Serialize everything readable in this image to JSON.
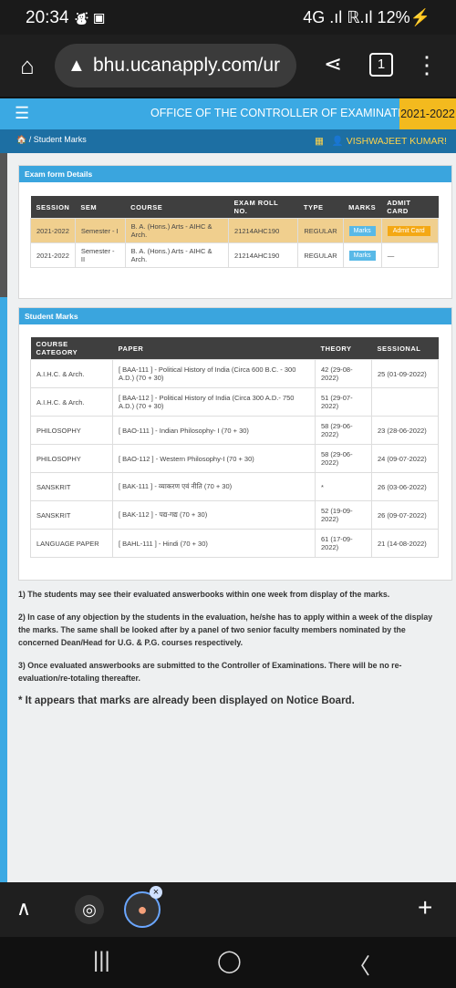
{
  "status_bar": {
    "time": "20:34",
    "icons": "⛇ ▣",
    "right": "4G .ıl ℝ.ıl 12%⚡"
  },
  "browser": {
    "url": "bhu.ucanapply.com/ur",
    "tab_count": "1"
  },
  "app_header": {
    "office_title": "OFFICE OF THE CONTROLLER OF EXAMINATIONS",
    "year": "2021-2022"
  },
  "breadcrumb": {
    "current": "Student Marks"
  },
  "user": {
    "name": "VISHWAJEET KUMAR!"
  },
  "exam_form": {
    "title": "Exam form Details",
    "columns": [
      "SESSION",
      "SEM",
      "COURSE",
      "EXAM ROLL NO.",
      "TYPE",
      "MARKS",
      "ADMIT CARD"
    ],
    "rows": [
      {
        "session": "2021-2022",
        "sem": "Semester - I",
        "course": "B. A. (Hons.) Arts - AIHC & Arch.",
        "roll": "21214AHC190",
        "type": "REGULAR",
        "marks": "Marks",
        "admit": "Admit Card"
      },
      {
        "session": "2021-2022",
        "sem": "Semester - II",
        "course": "B. A. (Hons.) Arts - AIHC & Arch.",
        "roll": "21214AHC190",
        "type": "REGULAR",
        "marks": "Marks",
        "admit": "—"
      }
    ]
  },
  "student_marks": {
    "title": "Student Marks",
    "columns": [
      "COURSE CATEGORY",
      "PAPER",
      "THEORY",
      "SESSIONAL"
    ],
    "rows": [
      {
        "category": "A.I.H.C. & Arch.",
        "paper": "[ BAA-111 ] - Political History of India (Circa 600 B.C. - 300 A.D.) (70 + 30)",
        "theory": "42 (29-08-2022)",
        "sessional": "25 (01-09-2022)"
      },
      {
        "category": "A.I.H.C. & Arch.",
        "paper": "[ BAA-112 ] - Political History of India (Circa 300 A.D.- 750 A.D.) (70 + 30)",
        "theory": "51 (29-07-2022)",
        "sessional": ""
      },
      {
        "category": "PHILOSOPHY",
        "paper": "[ BAO-111 ] - Indian Philosophy- I (70 + 30)",
        "theory": "58 (29-06-2022)",
        "sessional": "23 (28-06-2022)"
      },
      {
        "category": "PHILOSOPHY",
        "paper": "[ BAO-112 ] - Western Philosophy-I (70 + 30)",
        "theory": "58 (29-06-2022)",
        "sessional": "24 (09-07-2022)"
      },
      {
        "category": "SANSKRIT",
        "paper": "[ BAK-111 ] - व्याकरण एवं नीति (70 + 30)",
        "theory": "*",
        "sessional": "26 (03-06-2022)"
      },
      {
        "category": "SANSKRIT",
        "paper": "[ BAK-112 ] - पद्य-गद्य (70 + 30)",
        "theory": "52 (19-09-2022)",
        "sessional": "26 (09-07-2022)"
      },
      {
        "category": "LANGUAGE PAPER",
        "paper": "[ BAHL-111 ] - Hindi (70 + 30)",
        "theory": "61 (17-09-2022)",
        "sessional": "21 (14-08-2022)"
      }
    ]
  },
  "notes": [
    "1) The students may see their evaluated answerbooks within one week from display of the marks.",
    "2) In case of any objection by the students in the evaluation, he/she has to apply within a week of the display the marks. The same shall be looked after by a panel of two senior faculty members nominated by the concerned Dean/Head for U.G. & P.G. courses respectively.",
    "3) Once evaluated answerbooks are submitted to the Controller of Examinations. There will be no re-evaluation/re-totaling thereafter."
  ],
  "notice": "* It appears that marks are already been displayed on Notice Board.",
  "colors": {
    "accent": "#3ba9e3",
    "year_badge": "#f3ba1e",
    "highlight_row": "#f0cf8e",
    "dark_bar": "#1d6fa3"
  }
}
